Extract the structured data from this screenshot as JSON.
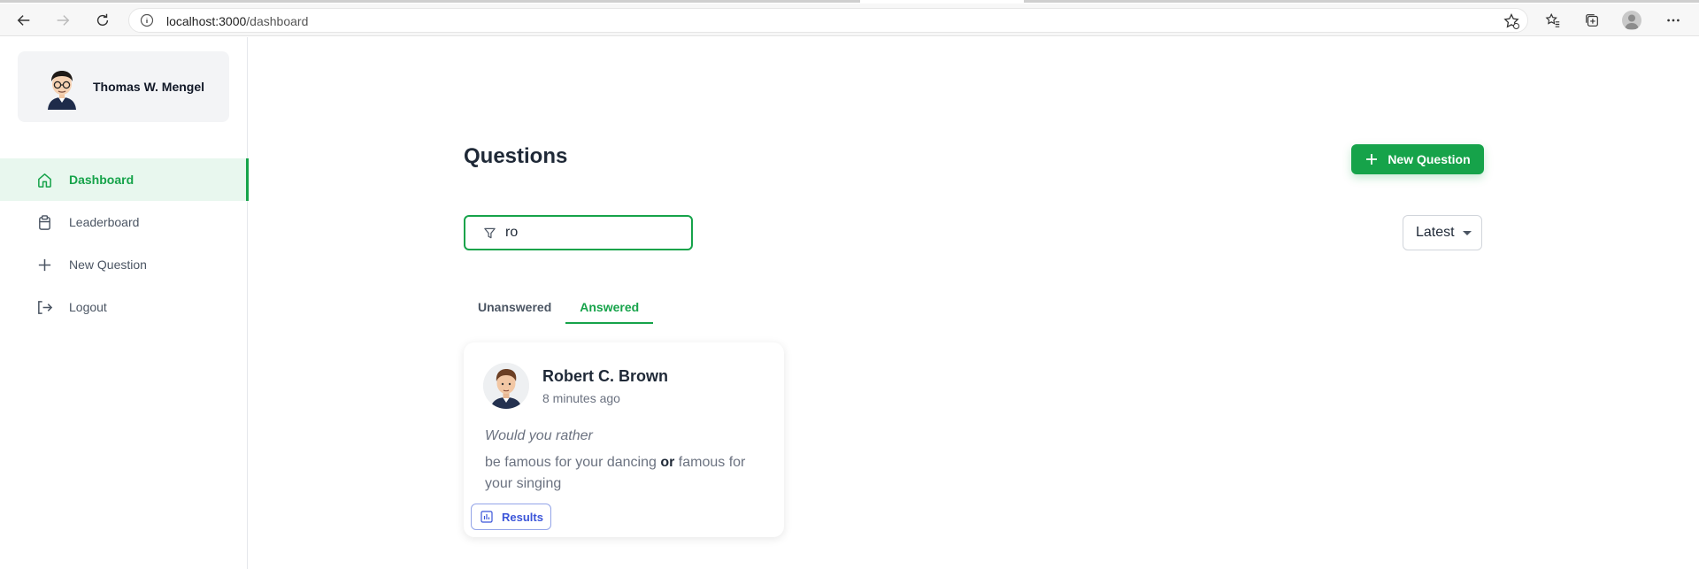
{
  "browser": {
    "url_host": "localhost:3000",
    "url_path": "/dashboard"
  },
  "user": {
    "name": "Thomas W. Mengel"
  },
  "sidebar": {
    "items": [
      {
        "label": "Dashboard",
        "icon": "home-icon",
        "active": true
      },
      {
        "label": "Leaderboard",
        "icon": "clipboard-icon",
        "active": false
      },
      {
        "label": "New Question",
        "icon": "plus-icon",
        "active": false
      },
      {
        "label": "Logout",
        "icon": "logout-icon",
        "active": false
      }
    ]
  },
  "main": {
    "title": "Questions",
    "new_question_label": "New Question",
    "filter": {
      "value": "ro",
      "icon": "filter-icon"
    },
    "sort": {
      "selected": "Latest"
    },
    "tabs": [
      {
        "label": "Unanswered",
        "active": false
      },
      {
        "label": "Answered",
        "active": true
      }
    ],
    "cards": [
      {
        "author": "Robert C. Brown",
        "time": "8 minutes ago",
        "prompt": "Would you rather",
        "option_one": "be famous for your dancing",
        "connector": "or",
        "option_two": "famous for your singing",
        "results_label": "Results"
      }
    ]
  },
  "colors": {
    "accent": "#16a34a",
    "accent_bg": "#e8f7ee",
    "results_blue": "#3b55d9"
  }
}
